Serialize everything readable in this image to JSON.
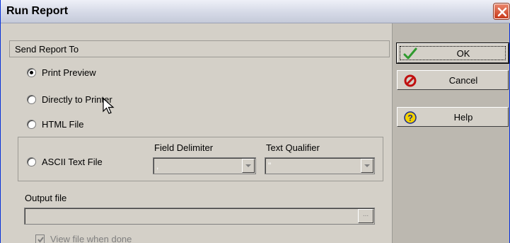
{
  "window": {
    "title": "Run Report"
  },
  "group": {
    "title": "Send Report To"
  },
  "options": [
    {
      "label": "Print Preview",
      "checked": true
    },
    {
      "label": "Directly to Printer",
      "checked": false
    },
    {
      "label": "HTML File",
      "checked": false
    },
    {
      "label": "ASCII Text File",
      "checked": false
    }
  ],
  "ascii": {
    "field_delimiter_label": "Field Delimiter",
    "field_delimiter_value": ",",
    "text_qualifier_label": "Text Qualifier",
    "text_qualifier_value": "\""
  },
  "output": {
    "label": "Output file",
    "value": "",
    "browse_label": "..."
  },
  "view_when_done": {
    "label": "View file when done",
    "checked": true,
    "enabled": false
  },
  "buttons": {
    "ok": "OK",
    "cancel": "Cancel",
    "help": "Help"
  },
  "colors": {
    "title_close": "#d0482a",
    "ok_check": "#2e9a2e",
    "cancel_icon": "#c01010",
    "help_icon": "#f2d000"
  },
  "icons": {
    "close": "close-icon",
    "ok": "checkmark-icon",
    "cancel": "no-entry-icon",
    "help": "question-icon"
  }
}
